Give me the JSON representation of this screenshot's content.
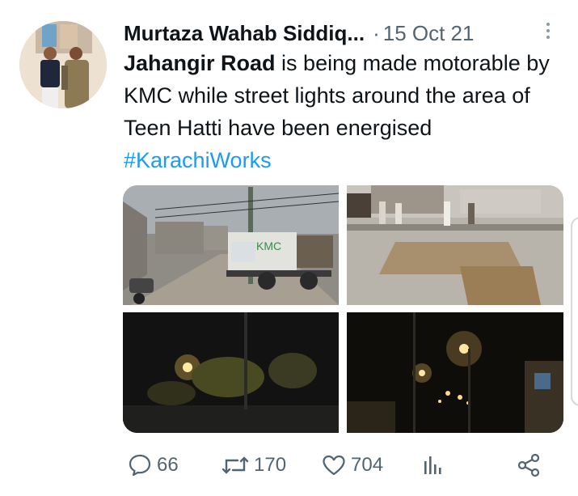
{
  "tweet": {
    "author_name": "Murtaza Wahab Siddiq...",
    "separator": "·",
    "date": "15 Oct 21",
    "text_bold": "Jahangir Road",
    "text_body": " is being made motorable by KMC while street lights around the area of Teen Hatti have been energised ",
    "hashtag": "#KarachiWorks",
    "truck_label": "KMC"
  },
  "actions": {
    "replies": "66",
    "retweets": "170",
    "likes": "704"
  },
  "icons": {
    "more": "more-vertical-icon",
    "reply": "comment-bubble-icon",
    "retweet": "retweet-icon",
    "like": "heart-icon",
    "views": "analytics-bars-icon",
    "share": "share-nodes-icon"
  },
  "colors": {
    "text": "#0f1419",
    "muted": "#536471",
    "link": "#1d9bf0"
  }
}
